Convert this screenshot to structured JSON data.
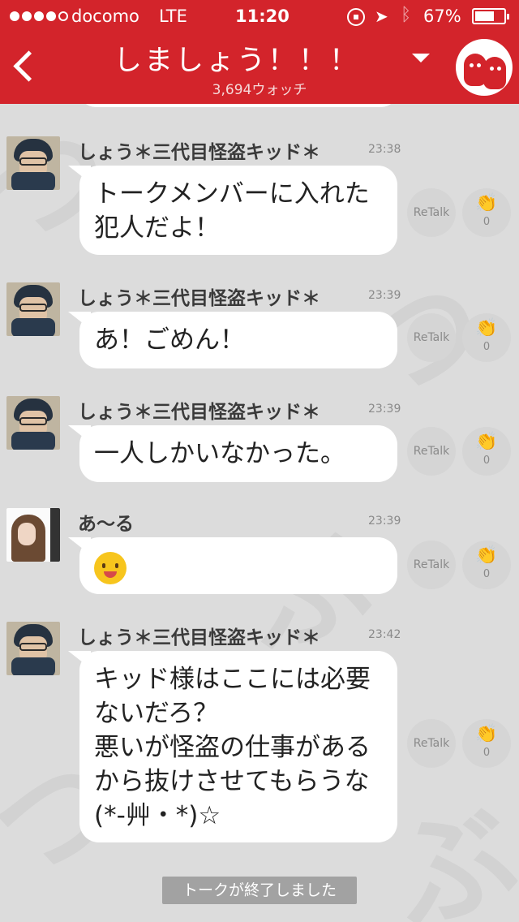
{
  "status_bar": {
    "carrier": "docomo",
    "network": "LTE",
    "time": "11:20",
    "battery": "67%",
    "battery_level": 0.67
  },
  "header": {
    "title": "しましょう！！！",
    "watch_count": "3,694ウォッチ"
  },
  "messages": [
    {
      "author": "しょう＊三代目怪盗キッド＊",
      "time": "23:38",
      "lines": [
        "トークメンバーに入れた",
        "犯人だよ！"
      ],
      "retalk": "ReTalk",
      "claps": "0"
    },
    {
      "author": "しょう＊三代目怪盗キッド＊",
      "time": "23:39",
      "lines": [
        "あ！ごめん！"
      ],
      "retalk": "ReTalk",
      "claps": "0"
    },
    {
      "author": "しょう＊三代目怪盗キッド＊",
      "time": "23:39",
      "lines": [
        "一人しかいなかった。"
      ],
      "retalk": "ReTalk",
      "claps": "0"
    },
    {
      "author": "あ〜る",
      "time": "23:39",
      "sticker": "smile-emoji",
      "retalk": "ReTalk",
      "claps": "0"
    },
    {
      "author": "しょう＊三代目怪盗キッド＊",
      "time": "23:42",
      "lines": [
        "キッド様はここには必要",
        "ないだろ？",
        "悪いが怪盗の仕事がある",
        "から抜けさせてもらうな",
        "(*-艸・*)☆"
      ],
      "retalk": "ReTalk",
      "claps": "0"
    }
  ],
  "footer": {
    "end_notice": "トークが終了しました"
  },
  "icons": {
    "back": "back-chevron-icon",
    "dropdown": "dropdown-triangle-icon",
    "clap": "clap-icon",
    "location": "location-arrow-icon",
    "bluetooth": "bluetooth-icon",
    "rotation_lock": "rotation-lock-icon"
  },
  "colors": {
    "brand": "#d3242b",
    "background": "#dcdcdc",
    "bubble": "#ffffff"
  }
}
